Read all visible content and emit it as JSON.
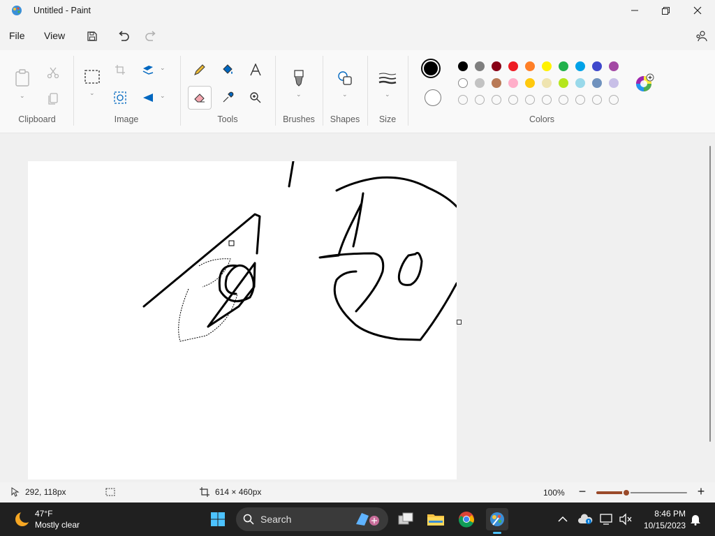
{
  "window": {
    "title": "Untitled - Paint"
  },
  "menu": {
    "file": "File",
    "view": "View"
  },
  "ribbon": {
    "clipboard": "Clipboard",
    "image": "Image",
    "tools": "Tools",
    "brushes": "Brushes",
    "shapes": "Shapes",
    "size": "Size",
    "colors": "Colors"
  },
  "palette": {
    "row1": [
      "#000000",
      "#7f7f7f",
      "#880015",
      "#ed1c24",
      "#ff7f27",
      "#fff200",
      "#22b14c",
      "#00a2e8",
      "#3f48cc",
      "#a349a4"
    ],
    "row2": [
      "#ffffff",
      "#c3c3c3",
      "#b97a57",
      "#ffaec9",
      "#ffc90e",
      "#efe4b0",
      "#b5e61d",
      "#99d9ea",
      "#7092be",
      "#c8bfe7"
    ],
    "primary": "#000000",
    "secondary": "#ffffff"
  },
  "status": {
    "cursor_pos": "292, 118px",
    "canvas_size": "614 × 460px",
    "zoom": "100%",
    "zoom_fraction": 0.33
  },
  "taskbar": {
    "temp": "47°F",
    "weather": "Mostly clear",
    "search": "Search",
    "time": "8:46 PM",
    "date": "10/15/2023"
  },
  "accent": "#0067c0"
}
